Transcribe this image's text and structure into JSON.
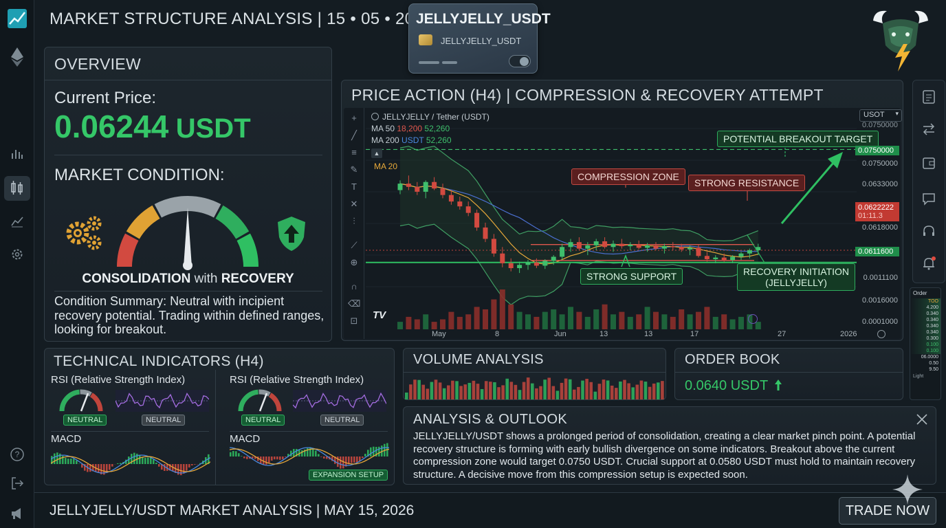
{
  "header": {
    "title": "MARKET STRUCTURE ANALYSIS | 15 • 05 • 2026",
    "pair_card": {
      "big": "JELLYJELLY_USDT",
      "small": "JELLYJELLY_USDT"
    }
  },
  "overview": {
    "title": "OVERVIEW",
    "price_label": "Current Price:",
    "price_value": "0.06244",
    "price_unit": "USDT",
    "condition_label": "MARKET CONDITION:",
    "condition_value_a": "CONSOLIDATION",
    "condition_value_b": "with",
    "condition_value_c": "RECOVERY",
    "gauge_level": 0.5,
    "summary": "Condition Summary: Neutral with incipient recovery potential. Trading within defined ranges, looking for breakout."
  },
  "chart_panel": {
    "title": "PRICE ACTION (H4) | COMPRESSION & RECOVERY ATTEMPT",
    "symbol": "JELLYJELLY / Tether (USDT)",
    "ma50_label": "MA 50",
    "ma50_v1": "18,200",
    "ma50_v2": "52,260",
    "ma200_label": "MA 200",
    "ma200_v1": "USDT",
    "ma200_v2": "52,260",
    "ma20_label": "MA 20",
    "currency_select": "USOT",
    "annotations": {
      "breakout": "POTENTIAL BREAKOUT TARGET",
      "compression": "COMPRESSION ZONE",
      "resistance": "STRONG RESISTANCE",
      "support": "STRONG SUPPORT",
      "recovery_1": "RECOVERY INITIATION",
      "recovery_2": "(JELLYJELLY)"
    },
    "y_ticks": [
      "0.0750000",
      "0.0750000",
      "0.0633000",
      "0.0622222",
      "01:11.3",
      "0.0618000",
      "0.0611600",
      "0.0011100",
      "0.0016000",
      "0.0001000"
    ],
    "x_ticks": [
      "May",
      "8",
      "Jun",
      "13",
      "13",
      "17",
      "27",
      "2026"
    ],
    "tv_logo": "TV"
  },
  "chart_data": {
    "type": "candlestick",
    "title": "PRICE ACTION (H4) | COMPRESSION & RECOVERY ATTEMPT",
    "levels": {
      "breakout_target": 0.075,
      "resistance": 0.0633,
      "support": 0.0611
    },
    "candles": [
      [
        0.07,
        0.0712,
        0.0695,
        0.0708
      ],
      [
        0.0708,
        0.0718,
        0.07,
        0.0704
      ],
      [
        0.0704,
        0.071,
        0.0694,
        0.0698
      ],
      [
        0.0698,
        0.0712,
        0.069,
        0.071
      ],
      [
        0.071,
        0.0716,
        0.07,
        0.0702
      ],
      [
        0.0702,
        0.0708,
        0.069,
        0.0694
      ],
      [
        0.0694,
        0.07,
        0.0682,
        0.0686
      ],
      [
        0.0686,
        0.0692,
        0.0676,
        0.068
      ],
      [
        0.068,
        0.0686,
        0.0668,
        0.0672
      ],
      [
        0.0672,
        0.0676,
        0.065,
        0.0654
      ],
      [
        0.0654,
        0.066,
        0.0636,
        0.064
      ],
      [
        0.064,
        0.0646,
        0.0618,
        0.0622
      ],
      [
        0.0622,
        0.063,
        0.0605,
        0.061
      ],
      [
        0.061,
        0.0616,
        0.06,
        0.0604
      ],
      [
        0.0604,
        0.0612,
        0.0598,
        0.0608
      ],
      [
        0.0608,
        0.0614,
        0.0602,
        0.0611
      ],
      [
        0.0611,
        0.0616,
        0.0604,
        0.0607
      ],
      [
        0.0607,
        0.0615,
        0.0603,
        0.0613
      ],
      [
        0.0613,
        0.062,
        0.0608,
        0.0618
      ],
      [
        0.0618,
        0.0634,
        0.0614,
        0.063
      ],
      [
        0.063,
        0.064,
        0.0624,
        0.0636
      ],
      [
        0.0636,
        0.0642,
        0.0626,
        0.0628
      ],
      [
        0.0628,
        0.0636,
        0.062,
        0.0632
      ],
      [
        0.0632,
        0.064,
        0.0626,
        0.0637
      ],
      [
        0.0637,
        0.0642,
        0.0628,
        0.063
      ],
      [
        0.063,
        0.0638,
        0.0624,
        0.0634
      ],
      [
        0.0634,
        0.064,
        0.0628,
        0.0631
      ],
      [
        0.0631,
        0.0636,
        0.0626,
        0.0633
      ],
      [
        0.0633,
        0.0638,
        0.0627,
        0.0629
      ],
      [
        0.0629,
        0.0635,
        0.0624,
        0.0632
      ],
      [
        0.0632,
        0.0636,
        0.0626,
        0.0628
      ],
      [
        0.0628,
        0.0634,
        0.0622,
        0.0631
      ],
      [
        0.0631,
        0.0636,
        0.0626,
        0.063
      ],
      [
        0.063,
        0.0634,
        0.0624,
        0.0627
      ],
      [
        0.0627,
        0.0632,
        0.062,
        0.0629
      ],
      [
        0.0629,
        0.0633,
        0.0617,
        0.0619
      ],
      [
        0.0619,
        0.0624,
        0.0612,
        0.0615
      ],
      [
        0.0615,
        0.062,
        0.061,
        0.0617
      ],
      [
        0.0617,
        0.0622,
        0.0612,
        0.0614
      ],
      [
        0.0614,
        0.062,
        0.061,
        0.0618
      ],
      [
        0.0618,
        0.0624,
        0.0614,
        0.0622
      ],
      [
        0.0622,
        0.0628,
        0.0616,
        0.0626
      ],
      [
        0.0626,
        0.0634,
        0.062,
        0.063
      ]
    ],
    "volume": [
      3,
      5,
      4,
      6,
      3,
      4,
      7,
      5,
      6,
      9,
      8,
      12,
      16,
      10,
      7,
      6,
      5,
      7,
      8,
      6,
      9,
      7,
      5,
      8,
      10,
      6,
      7,
      5,
      6,
      9,
      7,
      6,
      5,
      8,
      6,
      7,
      9,
      5,
      6,
      4,
      5,
      6,
      3
    ]
  },
  "tech": {
    "title": "TECHNICAL INDICATORS (H4)",
    "left": {
      "rsi": "RSI (Relative Strength Index)",
      "tag1": "NEUTRAL",
      "tag2": "NEUTRAL",
      "macd": "MACD"
    },
    "right": {
      "rsi": "RSI (Relative Strength Index)",
      "tag1": "NEUTRAL",
      "tag2": "NEUTRAL",
      "macd": "MACD",
      "macd_tag": "EXPANSION SETUP"
    }
  },
  "volume_panel": {
    "title": "VOLUME ANALYSIS"
  },
  "order_book": {
    "title": "ORDER BOOK",
    "value": "0.0640 USDT",
    "mini_title": "Order",
    "mini_rows": [
      "TOO",
      "4.200",
      "0.340",
      "0.340",
      "0.340",
      "0.340",
      "0.300",
      "0.100",
      "0.100",
      "06.0000",
      "0.50",
      "9.50"
    ],
    "mini_footer": "Light"
  },
  "outlook": {
    "title": "ANALYSIS & OUTLOOK",
    "text": "JELLYJELLY/USDT shows a prolonged period of consolidation, creating a clear market pinch point. A potential recovery structure is forming with early bullish divergence on some indicators. Breakout above the current compression zone would target 0.0750 USDT. Crucial support at 0.0580 USDT must hold to maintain recovery structure. A decisive move from this compression setup is expected soon."
  },
  "footer": {
    "title": "JELLYJELLY/USDT MARKET ANALYSIS | MAY 15, 2026",
    "trade_button": "TRADE NOW"
  },
  "colors": {
    "green": "#2fbf62",
    "red": "#d24a40",
    "bg": "#141c22",
    "panel": "#1c252c"
  },
  "icons": [
    "logo-icon",
    "ethereum-icon",
    "bar-chart-icon",
    "candlestick-icon",
    "line-chart-icon",
    "gear-icon",
    "help-icon",
    "logout-icon",
    "megaphone-icon",
    "document-icon",
    "swap-icon",
    "wallet-icon",
    "chat-icon",
    "headset-icon",
    "bell-icon",
    "bull-logo-icon",
    "close-icon",
    "sparkle-icon",
    "shield-arrow-icon",
    "gears-icon"
  ]
}
